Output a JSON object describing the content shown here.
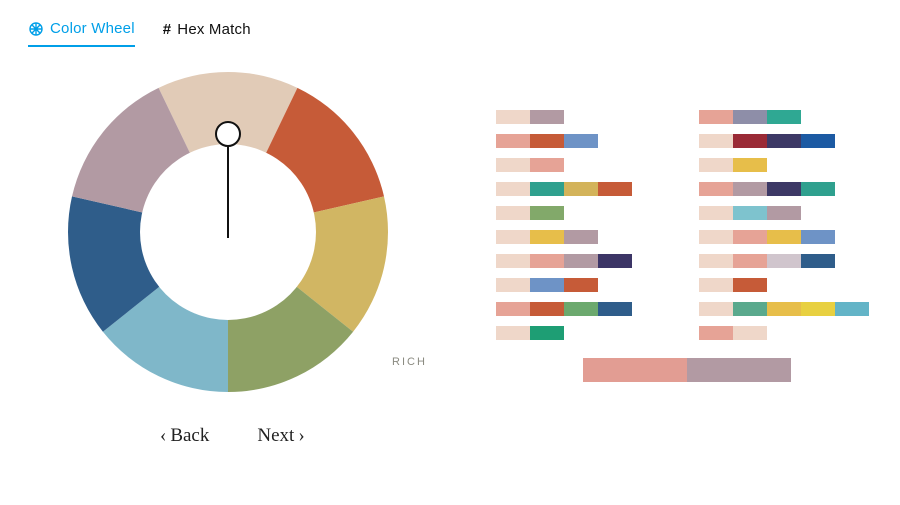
{
  "tabs": {
    "color_wheel": "Color Wheel",
    "hex_match": "Hex Match",
    "active": "color_wheel"
  },
  "wheel": {
    "label_rich": "RICH",
    "segments": [
      {
        "name": "beige",
        "color": "#e1cbb7"
      },
      {
        "name": "rust",
        "color": "#c65b38"
      },
      {
        "name": "mustard",
        "color": "#d1b663"
      },
      {
        "name": "olive",
        "color": "#8ea165"
      },
      {
        "name": "skyblue",
        "color": "#7fb7c9"
      },
      {
        "name": "navy",
        "color": "#2f5d8a"
      },
      {
        "name": "mauve",
        "color": "#b29aa3"
      }
    ]
  },
  "nav": {
    "back": "Back",
    "next": "Next"
  },
  "palettes": {
    "left": [
      [
        {
          "c": "#efd7c9",
          "w": 34
        },
        {
          "c": "#b29aa3",
          "w": 34
        }
      ],
      [
        {
          "c": "#e6a396",
          "w": 34
        },
        {
          "c": "#c65b38",
          "w": 34
        },
        {
          "c": "#6e93c6",
          "w": 34
        }
      ],
      [
        {
          "c": "#efd7c9",
          "w": 34
        },
        {
          "c": "#e6a396",
          "w": 34
        }
      ],
      [
        {
          "c": "#efd7c9",
          "w": 34
        },
        {
          "c": "#2fa08e",
          "w": 34
        },
        {
          "c": "#d3b35a",
          "w": 34
        },
        {
          "c": "#c65b38",
          "w": 34
        }
      ],
      [
        {
          "c": "#efd7c9",
          "w": 34
        },
        {
          "c": "#82a96a",
          "w": 34
        }
      ],
      [
        {
          "c": "#efd7c9",
          "w": 34
        },
        {
          "c": "#e7be4a",
          "w": 34
        },
        {
          "c": "#b29aa3",
          "w": 34
        }
      ],
      [
        {
          "c": "#efd7c9",
          "w": 34
        },
        {
          "c": "#e6a396",
          "w": 34
        },
        {
          "c": "#b29aa3",
          "w": 34
        },
        {
          "c": "#3c3566",
          "w": 34
        }
      ],
      [
        {
          "c": "#efd7c9",
          "w": 34
        },
        {
          "c": "#6e93c6",
          "w": 34
        },
        {
          "c": "#c65b38",
          "w": 34
        }
      ],
      [
        {
          "c": "#e6a396",
          "w": 34
        },
        {
          "c": "#c65b38",
          "w": 34
        },
        {
          "c": "#6ca96e",
          "w": 34
        },
        {
          "c": "#2f5d8a",
          "w": 34
        }
      ],
      [
        {
          "c": "#efd7c9",
          "w": 34
        },
        {
          "c": "#1e9e74",
          "w": 34
        }
      ]
    ],
    "right": [
      [
        {
          "c": "#e6a396",
          "w": 34
        },
        {
          "c": "#8e8ea8",
          "w": 34
        },
        {
          "c": "#2fa893",
          "w": 34
        }
      ],
      [
        {
          "c": "#efd7c9",
          "w": 34
        },
        {
          "c": "#9a2a36",
          "w": 34
        },
        {
          "c": "#3d3966",
          "w": 34
        },
        {
          "c": "#1c5aa3",
          "w": 34
        }
      ],
      [
        {
          "c": "#efd7c9",
          "w": 34
        },
        {
          "c": "#e7be4a",
          "w": 34
        }
      ],
      [
        {
          "c": "#e6a396",
          "w": 34
        },
        {
          "c": "#b29aa3",
          "w": 34
        },
        {
          "c": "#3d3966",
          "w": 34
        },
        {
          "c": "#2fa08e",
          "w": 34
        }
      ],
      [
        {
          "c": "#efd7c9",
          "w": 34
        },
        {
          "c": "#7ec3ce",
          "w": 34
        },
        {
          "c": "#b29aa3",
          "w": 34
        }
      ],
      [
        {
          "c": "#efd7c9",
          "w": 34
        },
        {
          "c": "#e6a396",
          "w": 34
        },
        {
          "c": "#e7be4a",
          "w": 34
        },
        {
          "c": "#6e93c6",
          "w": 34
        }
      ],
      [
        {
          "c": "#efd7c9",
          "w": 34
        },
        {
          "c": "#e6a396",
          "w": 34
        },
        {
          "c": "#d0c5cd",
          "w": 34
        },
        {
          "c": "#2f5d8a",
          "w": 34
        }
      ],
      [
        {
          "c": "#efd7c9",
          "w": 34
        },
        {
          "c": "#c65b38",
          "w": 34
        }
      ],
      [
        {
          "c": "#efd7c9",
          "w": 34
        },
        {
          "c": "#5aa98d",
          "w": 34
        },
        {
          "c": "#e7be4a",
          "w": 34
        },
        {
          "c": "#e8d041",
          "w": 34
        },
        {
          "c": "#63b4c7",
          "w": 34
        }
      ],
      [
        {
          "c": "#e6a396",
          "w": 34
        },
        {
          "c": "#efd7c9",
          "w": 34
        }
      ]
    ],
    "selected": [
      {
        "c": "#e29d93",
        "w": 104
      },
      {
        "c": "#b29aa3",
        "w": 104
      }
    ]
  }
}
